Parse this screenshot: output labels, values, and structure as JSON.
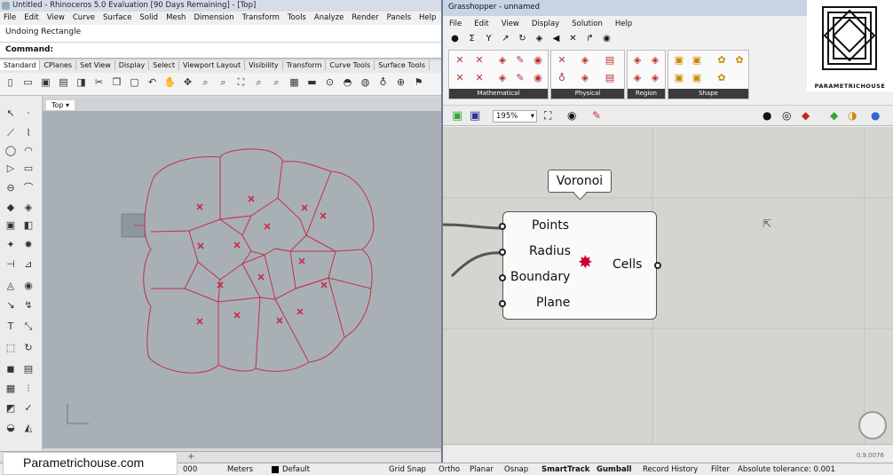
{
  "rhino": {
    "title": "Untitled - Rhinoceros 5.0 Evaluation [90 Days Remaining] - [Top]",
    "menu": [
      "File",
      "Edit",
      "View",
      "Curve",
      "Surface",
      "Solid",
      "Mesh",
      "Dimension",
      "Transform",
      "Tools",
      "Analyze",
      "Render",
      "Panels",
      "Help"
    ],
    "command_history": "Undoing Rectangle",
    "command_prompt": "Command:",
    "tabs": [
      "Standard",
      "CPlanes",
      "Set View",
      "Display",
      "Select",
      "Viewport Layout",
      "Visibility",
      "Transform",
      "Curve Tools",
      "Surface Tools"
    ],
    "active_tab": "Standard",
    "viewport_label": "Top",
    "viewport_dropdown": "▾"
  },
  "status": {
    "coord": "000",
    "units": "Meters",
    "layer": "Default",
    "grid_snap": "Grid Snap",
    "ortho": "Ortho",
    "planar": "Planar",
    "osnap": "Osnap",
    "smarttrack": "SmartTrack",
    "gumball": "Gumball",
    "record_history": "Record History",
    "filter": "Filter",
    "tolerance": "Absolute tolerance: 0.001"
  },
  "watermark": "Parametrichouse.com",
  "logo_text": "PARAMETRICHOUSE",
  "grasshopper": {
    "title": "Grasshopper - unnamed",
    "menu": [
      "File",
      "Edit",
      "View",
      "Display",
      "Solution",
      "Help"
    ],
    "palettes": [
      "Mathematical",
      "Physical",
      "Region",
      "Shape"
    ],
    "zoom": "195%",
    "version": "0.9.0076",
    "tooltip": "Voronoi",
    "component": {
      "inputs": [
        "Points",
        "Radius",
        "Boundary",
        "Plane"
      ],
      "output": "Cells"
    }
  },
  "colors": {
    "curve": "#c0304a",
    "viewport_bg": "#a9b0b5",
    "gh_canvas": "#d4d5ce"
  }
}
